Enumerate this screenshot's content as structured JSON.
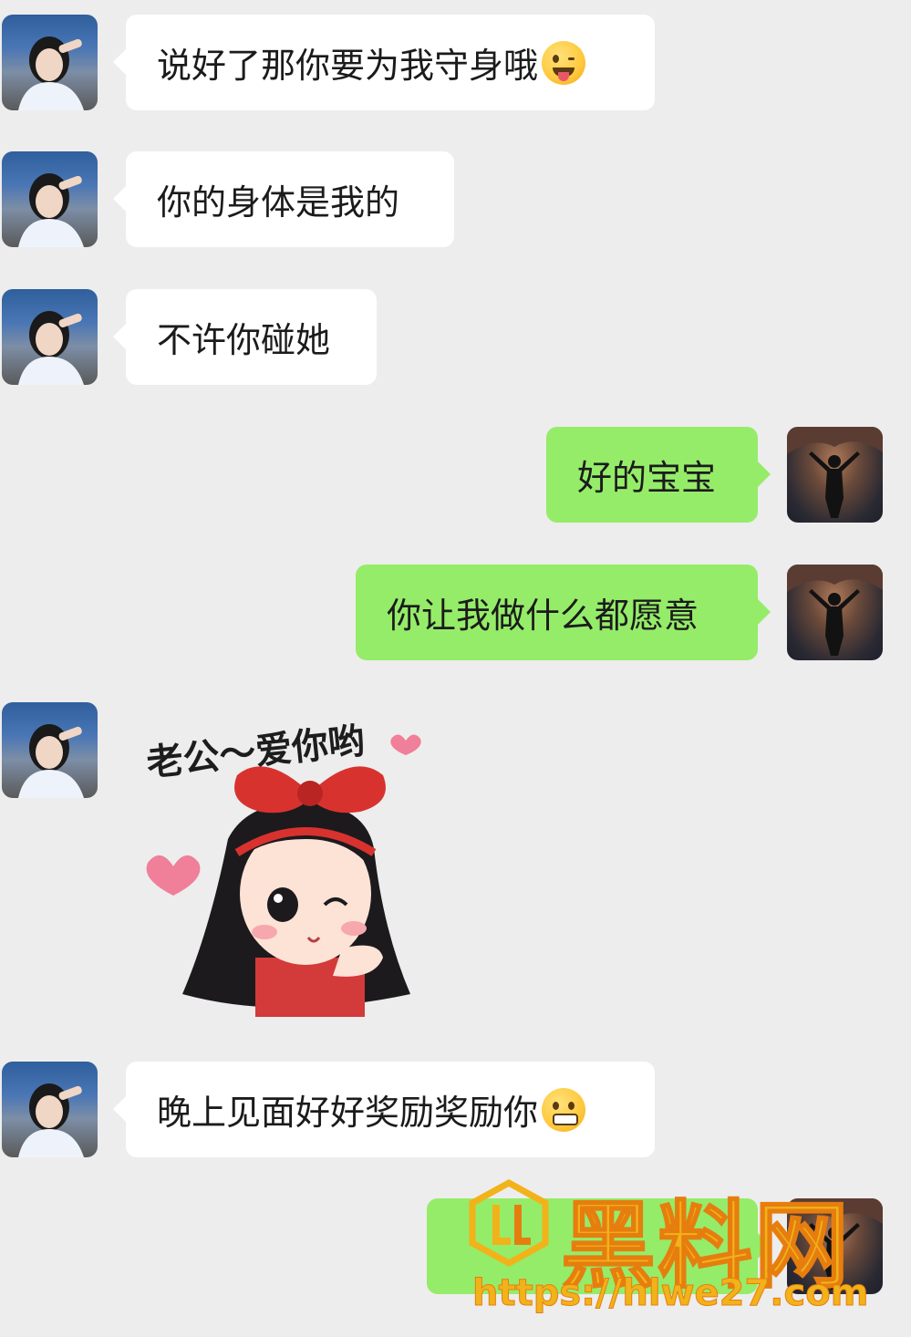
{
  "messages": [
    {
      "side": "left",
      "text": "说好了那你要为我守身哦",
      "emoji": "winking-tongue-emoji"
    },
    {
      "side": "left",
      "text": "你的身体是我的"
    },
    {
      "side": "left",
      "text": "不许你碰她"
    },
    {
      "side": "right",
      "text": "好的宝宝"
    },
    {
      "side": "right",
      "text": "你让我做什么都愿意"
    },
    {
      "side": "left",
      "sticker_caption": "老公～爱你哟"
    },
    {
      "side": "left",
      "text": "晚上见面好好奖励奖励你",
      "emoji": "grimacing-emoji"
    },
    {
      "side": "right",
      "text": ""
    }
  ],
  "watermark": {
    "title": "黑料网",
    "url": "https://hlwe27.com"
  },
  "colors": {
    "background": "#ededed",
    "incoming_bubble": "#ffffff",
    "outgoing_bubble": "#95ec69",
    "watermark": "#f2b21a"
  }
}
